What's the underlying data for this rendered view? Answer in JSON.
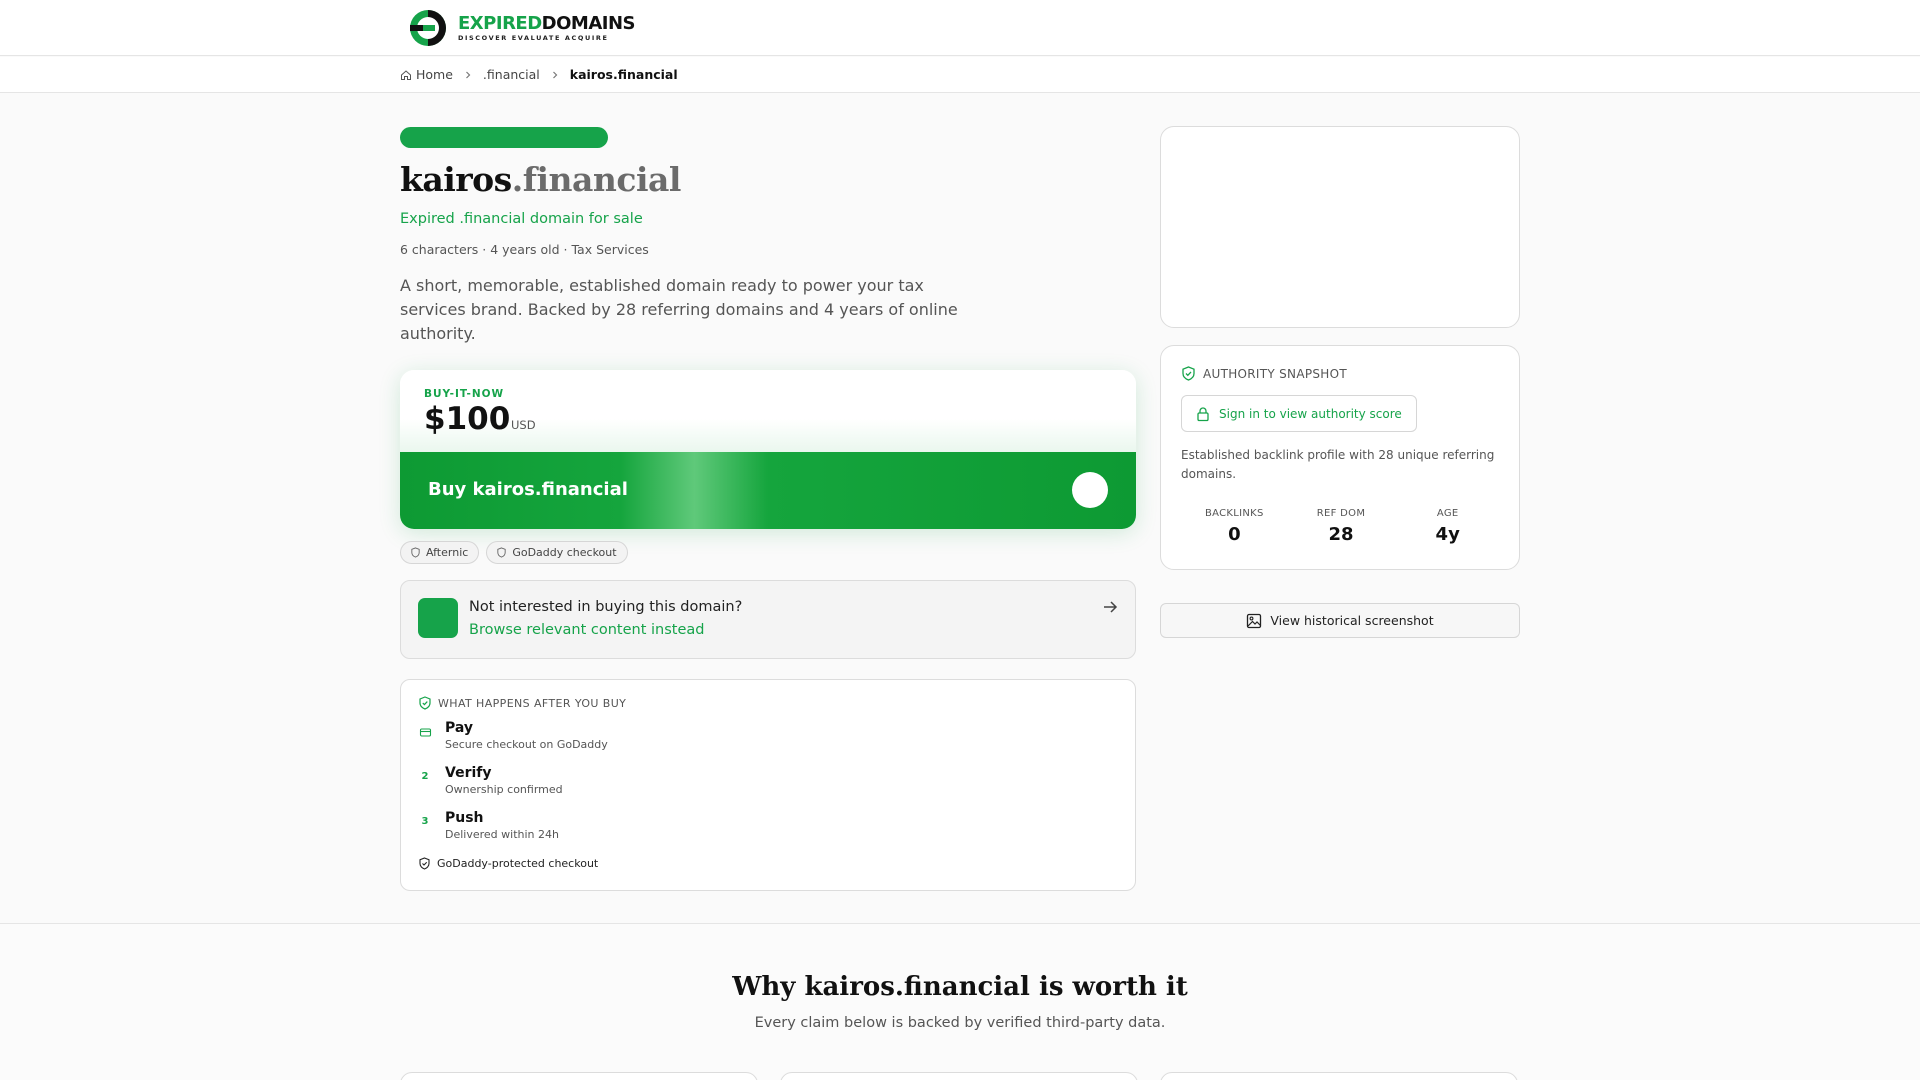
{
  "header": {
    "logo_brand_1": "EXPIRED",
    "logo_brand_2": "DOMAINS",
    "logo_tagline": "DISCOVER EVALUATE ACQUIRE"
  },
  "breadcrumb": {
    "home": "Home",
    "tld": ".financial",
    "current": "kairos.financial"
  },
  "domain": {
    "name": "kairos",
    "tld": ".financial",
    "subtitle": "Expired .financial domain for sale",
    "meta": "6 characters · 4 years old · Tax Services",
    "description": "A short, memorable, established domain ready to power your tax services brand. Backed by 28 referring domains and 4 years of online authority."
  },
  "buy": {
    "label": "BUY-IT-NOW",
    "price": "$100",
    "currency": "USD",
    "button": "Buy kairos.financial"
  },
  "chips": [
    "Afternic",
    "GoDaddy checkout"
  ],
  "browse": {
    "question": "Not interested in buying this domain?",
    "link": "Browse relevant content instead"
  },
  "steps": {
    "heading": "WHAT HAPPENS AFTER YOU BUY",
    "items": [
      {
        "num": "",
        "icon": "card-icon",
        "title": "Pay",
        "sub": "Secure checkout on GoDaddy"
      },
      {
        "num": "2",
        "title": "Verify",
        "sub": "Ownership confirmed"
      },
      {
        "num": "3",
        "title": "Push",
        "sub": "Delivered within 24h"
      }
    ],
    "footer": "GoDaddy-protected checkout"
  },
  "authority": {
    "heading": "AUTHORITY SNAPSHOT",
    "signin": "Sign in to view authority score",
    "note": "Established backlink profile with 28 unique referring domains.",
    "stats": [
      {
        "label": "BACKLINKS",
        "value": "0"
      },
      {
        "label": "REF DOM",
        "value": "28"
      },
      {
        "label": "AGE",
        "value": "4y"
      }
    ]
  },
  "history": {
    "button": "View historical screenshot"
  },
  "why": {
    "title": "Why kairos.financial is worth it",
    "subtitle": "Every claim below is backed by verified third-party data."
  },
  "colors": {
    "accent": "#16a34a",
    "text": "#111111",
    "muted": "#555555"
  }
}
